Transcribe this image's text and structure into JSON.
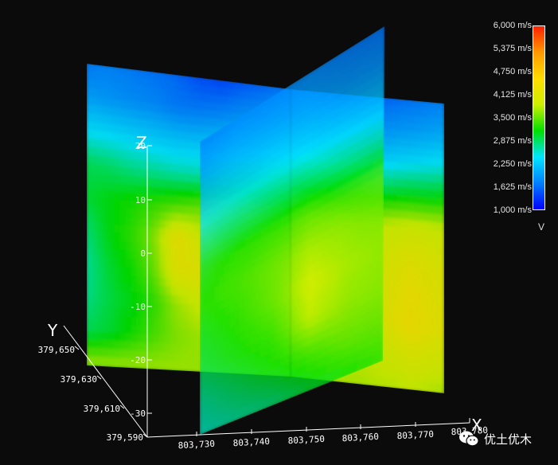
{
  "chart_data": {
    "type": "heatmap",
    "subtype": "3D orthogonal velocity slices",
    "variable": "V",
    "unit": "m/s",
    "colormap": [
      "#0000ff",
      "#0080ff",
      "#00e5ff",
      "#00e000",
      "#ccf000",
      "#ffdd00",
      "#ff9a00",
      "#ff2000"
    ],
    "colorbar_range": [
      1000,
      6000
    ],
    "colorbar_ticks": [
      "6,000 m/s",
      "5,375 m/s",
      "4,750 m/s",
      "4,125 m/s",
      "3,500 m/s",
      "2,875 m/s",
      "2,250 m/s",
      "1,625 m/s",
      "1,000 m/s"
    ],
    "legend_title": "V",
    "axes": {
      "x": {
        "label": "X",
        "range": [
          803730,
          803780
        ],
        "ticks": [
          "803,730",
          "803,740",
          "803,750",
          "803,760",
          "803,770",
          "803,780"
        ]
      },
      "y": {
        "label": "Y",
        "range": [
          379590,
          379650
        ],
        "ticks": [
          "379,590",
          "379,610",
          "379,630",
          "379,650"
        ]
      },
      "z": {
        "label": "Z",
        "range": [
          -30,
          20
        ],
        "ticks": [
          "20",
          "10",
          "0",
          "-10",
          "-20",
          "-30"
        ]
      }
    },
    "slices": [
      {
        "name": "slice-back-xz",
        "grid": [
          [
            1700,
            1750,
            1700,
            1650,
            1600,
            1450,
            1400,
            1500,
            1600,
            1700
          ],
          [
            1950,
            1900,
            1850,
            1800,
            1700,
            1700,
            1750,
            1850,
            1900,
            1950
          ],
          [
            2400,
            2350,
            2300,
            2250,
            2200,
            2200,
            2250,
            2300,
            2350,
            2400
          ],
          [
            2900,
            2850,
            2750,
            2700,
            2650,
            2650,
            2750,
            2850,
            2900,
            2950
          ],
          [
            3000,
            3100,
            3200,
            3300,
            3400,
            3500,
            3500,
            3500,
            3450,
            3400
          ],
          [
            2800,
            3100,
            3300,
            3600,
            4300,
            4000,
            3700,
            3600,
            3600,
            3550
          ],
          [
            2700,
            3000,
            3200,
            3500,
            4200,
            4200,
            3900,
            3700,
            3650,
            3600
          ],
          [
            2750,
            2950,
            3100,
            3300,
            3700,
            3900,
            3800,
            3700,
            3600,
            3550
          ],
          [
            2900,
            3000,
            3200,
            3400,
            3600,
            3700,
            3700,
            3650,
            3600,
            3550
          ],
          [
            3700,
            3700,
            3700,
            3700,
            3700,
            3700,
            3700,
            3700,
            3700,
            3700
          ]
        ]
      },
      {
        "name": "slice-front-xz",
        "grid": [
          [
            1800,
            1750,
            1700,
            1600,
            1550,
            1550,
            1600,
            1650,
            1700,
            1750
          ],
          [
            2000,
            1950,
            1900,
            1850,
            1850,
            1850,
            1900,
            1950,
            2000,
            2050
          ],
          [
            2400,
            2350,
            2300,
            2300,
            2300,
            2300,
            2350,
            2400,
            2450,
            2500
          ],
          [
            3100,
            3000,
            2900,
            2900,
            3000,
            3000,
            3050,
            3100,
            3100,
            3150
          ],
          [
            3700,
            3750,
            3800,
            3850,
            3750,
            3800,
            3900,
            3950,
            3950,
            3900
          ],
          [
            3800,
            3900,
            4000,
            4000,
            3850,
            3900,
            4100,
            4200,
            4150,
            4100
          ],
          [
            3800,
            3900,
            4050,
            4100,
            3900,
            4000,
            4200,
            4350,
            4250,
            4150
          ],
          [
            3750,
            3850,
            3950,
            4200,
            3950,
            4050,
            4250,
            4400,
            4300,
            4200
          ],
          [
            3700,
            3750,
            3800,
            3900,
            3850,
            3900,
            4000,
            4100,
            4050,
            4000
          ],
          [
            3600,
            3650,
            3700,
            3750,
            3750,
            3800,
            3800,
            3850,
            3800,
            3750
          ]
        ]
      },
      {
        "name": "slice-yz",
        "grid": [
          [
            1700,
            1800,
            1800,
            1800,
            1700,
            1650
          ],
          [
            1900,
            2000,
            2000,
            2000,
            1900,
            1850
          ],
          [
            2200,
            2250,
            2300,
            2300,
            2250,
            2200
          ],
          [
            2600,
            2700,
            2750,
            2800,
            2750,
            2700
          ],
          [
            3000,
            3200,
            3300,
            3400,
            3400,
            3450
          ],
          [
            3100,
            3300,
            3500,
            3700,
            3600,
            3550
          ],
          [
            3000,
            3200,
            3500,
            3900,
            3700,
            3600
          ],
          [
            2900,
            3100,
            3300,
            3800,
            3600,
            3550
          ],
          [
            2700,
            2900,
            3100,
            3300,
            3400,
            3400
          ],
          [
            2600,
            2700,
            2800,
            3000,
            3100,
            3200
          ]
        ]
      }
    ]
  },
  "watermark": {
    "text": "优土优木",
    "icon": "wechat-icon"
  }
}
